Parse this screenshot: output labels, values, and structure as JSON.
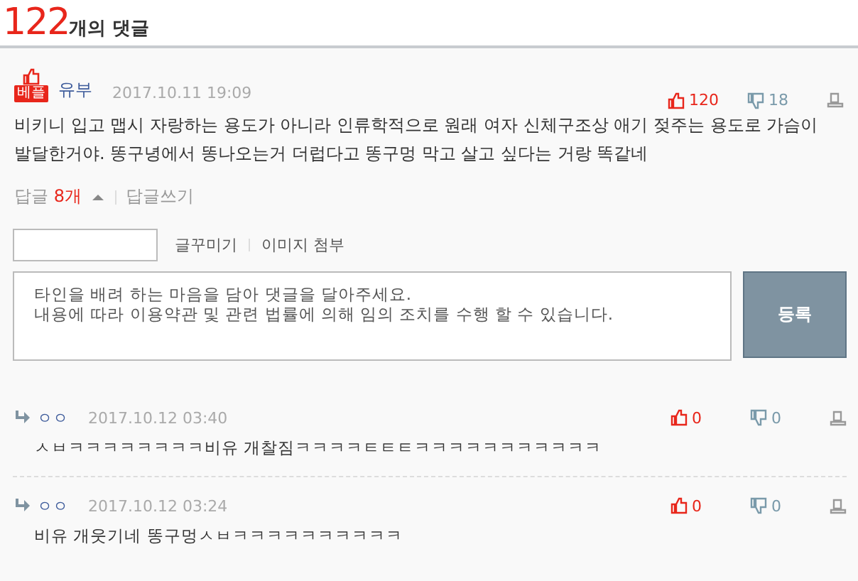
{
  "header": {
    "count": "122",
    "label": "개의 댓글"
  },
  "comment": {
    "badge": "베플",
    "author": "유부",
    "date": "2017.10.11 19:09",
    "likes": "120",
    "dislikes": "18",
    "text": "비키니 입고 맵시 자랑하는 용도가 아니라 인류학적으로 원래 여자 신체구조상 애기 젖주는 용도로 가슴이 발달한거야. 똥구녕에서 똥나오는거 더럽다고 똥구멍 막고 살고 싶다는 거랑 똑같네",
    "replies_label": "답글",
    "replies_count": "8개",
    "replies_expanded": true,
    "write_reply": "답글쓰기"
  },
  "editor": {
    "tools": [
      "글꾸미기",
      "이미지 첨부"
    ],
    "placeholder": "타인을 배려 하는 마음을 담아 댓글을 달아주세요.\n내용에 따라 이용약관 및 관련 법률에 의해 임의 조치를 수행 할 수 있습니다.",
    "submit": "등록"
  },
  "replies": [
    {
      "author": "ㅇㅇ",
      "date": "2017.10.12 03:40",
      "likes": "0",
      "dislikes": "0",
      "text": "ㅅㅂㅋㅋㅋㅋㅋㅋㅋㅋ비유 개찰짐ㅋㅋㅋㅋㅌㅌㅌㅋㅋㅋㅋㅋㅋㅋㅋㅋㅋㅋ"
    },
    {
      "author": "ㅇㅇ",
      "date": "2017.10.12 03:24",
      "likes": "0",
      "dislikes": "0",
      "text": "비유 개웃기네 똥구멍ㅅㅂㅋㅋㅋㅋㅋㅋㅋㅋㅋㅋ"
    }
  ]
}
